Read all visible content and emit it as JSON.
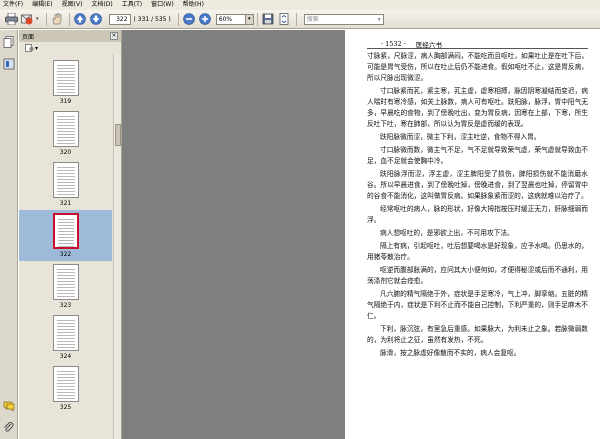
{
  "menu": [
    "文件(F)",
    "编辑(E)",
    "视图(V)",
    "文档(D)",
    "工具(T)",
    "窗口(W)",
    "帮助(H)"
  ],
  "toolbar": {
    "page_number": "322",
    "page_count": "( 331 / 535 )",
    "zoom": "60%",
    "search_placeholder": "搜索",
    "icons": [
      "print-icon",
      "email-icon",
      "hand-icon",
      "page-up-icon",
      "page-down-icon",
      "zoom-out-icon",
      "zoom-in-icon",
      "save-icon",
      "fit-page-icon"
    ]
  },
  "panel": {
    "title": "页面",
    "close": "×",
    "options": "▾",
    "thumbnails": [
      {
        "label": "319",
        "selected": false
      },
      {
        "label": "320",
        "selected": false
      },
      {
        "label": "321",
        "selected": false
      },
      {
        "label": "322",
        "selected": true
      },
      {
        "label": "323",
        "selected": false
      },
      {
        "label": "324",
        "selected": false
      },
      {
        "label": "325",
        "selected": false
      }
    ]
  },
  "document": {
    "page_header_num": "· 1532 ·",
    "page_header_title": "医经六书",
    "paragraphs": [
      {
        "style": "cont",
        "text": "寸脉紧，尺脉涩，病人胸部满闷，不能吃而且呕吐，如果吐止是在吐下后，可能是胃气受伤，所以在吐止后仍不能进食。假如呕吐不止，这是胃反病，所以尺脉出现微涩。"
      },
      {
        "style": "indent",
        "text": "寸口脉紧而芤，紧主寒，芤主虚，虚寒相搏，脉因阴寒凝结而变迟，病人喘时有寒冷感，如关上脉数，病人可有呕吐。趺阳脉，脉浮，胃中阳气无多，早晨吃的食物，到了傍晚吐出，变为胃反病，因寒在上部，下寒，所生反吐下吐，寒在肺部，所以认为胃反是虚而缓的表现。"
      },
      {
        "style": "indent",
        "text": "趺阳脉微而涩，微主下利，涩主吐逆，食物不得入胃。"
      },
      {
        "style": "indent",
        "text": "寸口脉微而数，微主气不足，气不足就导致荣气虚，荣气虚就导致血不足，血不足就会使胸中冷。"
      },
      {
        "style": "indent",
        "text": "趺阳脉浮而涩，浮主虚，涩主脾阳受了损伤，脾阳损伤就不能消磨水谷。所以早晨进食，到了傍晚吐掉，傍晚进食，到了翌晨也吐掉，停留胃中的谷食不能消化，这叫做胃反病。如果脉象紧而涩的，这病就难以治疗了。"
      },
      {
        "style": "indent",
        "text": "经常呕吐的病人，脉的形状，好像大拇指按压时缓正无力，肝脉细弱而浮。"
      },
      {
        "style": "indent",
        "text": "病人想呕吐的，是邪欲上出，不可用攻下法。"
      },
      {
        "style": "indent",
        "text": "隔上有病，引起呕吐，吐后想要喝水是好现象，应予水喝。仍思水的，用猪苓散治疗。"
      },
      {
        "style": "indent",
        "text": "呕逆而腹部胀满的，应问其大小便何如，才便得秘涩或后而不通利，用荡涤剂它就会痊愈。"
      },
      {
        "style": "indent",
        "text": "凡六腑的精气隔绝于外，症状是手足寒冷，气上冲，脚挛缩。五脏的精气隔绝于内，症状是下利不止而不能自己控制，下利严重的，则手足麻木不仁。"
      },
      {
        "style": "indent",
        "text": "下利，脉沉弦，有里急后重感。如果脉大，为利未止之象。若脉微弱数的，为利将止之征，虽然有发热，不死。"
      },
      {
        "style": "indent",
        "text": "脉滑，按之脉虚好像散而不实的，病人会复呕。"
      }
    ]
  }
}
